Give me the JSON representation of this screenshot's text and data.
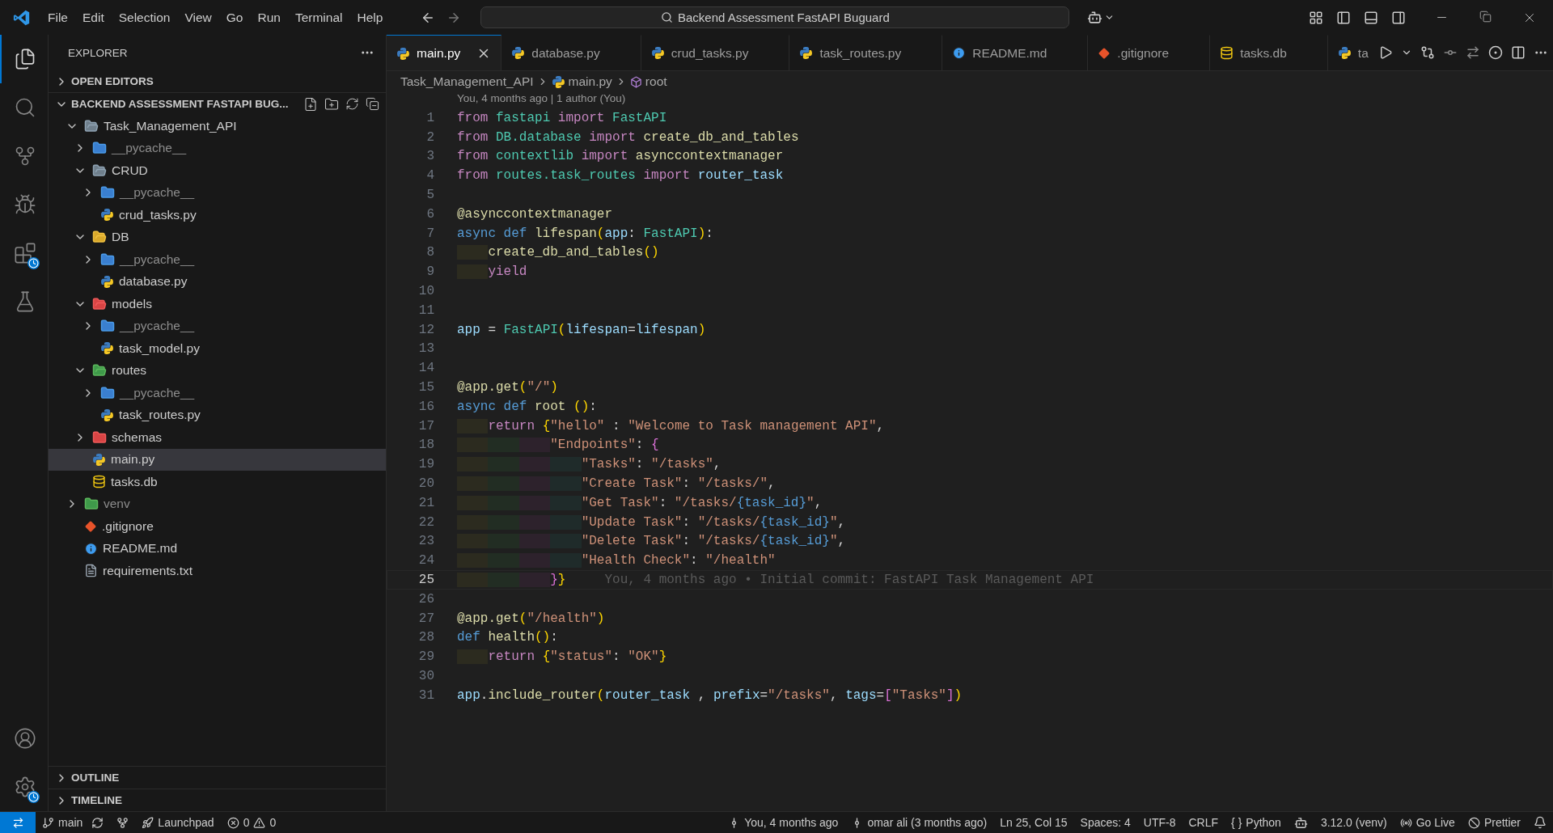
{
  "title_bar": {
    "menu": [
      "File",
      "Edit",
      "Selection",
      "View",
      "Go",
      "Run",
      "Terminal",
      "Help"
    ],
    "command_center": "Backend Assessment FastAPI Buguard"
  },
  "activity_bar": [
    {
      "kind": "explorer",
      "selected": true
    },
    {
      "kind": "search",
      "selected": false
    },
    {
      "kind": "scm",
      "selected": false
    },
    {
      "kind": "debug",
      "selected": false
    },
    {
      "kind": "extensions",
      "selected": false
    },
    {
      "kind": "testing",
      "selected": false
    }
  ],
  "activity_bar_bottom": [
    {
      "kind": "account"
    },
    {
      "kind": "settings"
    }
  ],
  "sidebar": {
    "title": "EXPLORER",
    "open_editors": {
      "label": "OPEN EDITORS",
      "expanded": false
    },
    "project": {
      "label": "BACKEND ASSESSMENT FASTAPI BUG...",
      "expanded": true
    },
    "tree": [
      {
        "label": "Task_Management_API",
        "kind": "folder",
        "expanded": true,
        "selected": false,
        "dimmed": false,
        "children": [
          {
            "label": "__pycache__",
            "kind": "folder-py",
            "expanded": false,
            "selected": false,
            "dimmed": true
          },
          {
            "label": "CRUD",
            "kind": "folder",
            "expanded": true,
            "selected": false,
            "dimmed": false,
            "children": [
              {
                "label": "__pycache__",
                "kind": "folder-py",
                "expanded": false,
                "selected": false,
                "dimmed": true
              },
              {
                "label": "crud_tasks.py",
                "kind": "python",
                "selected": false,
                "dimmed": false
              }
            ]
          },
          {
            "label": "DB",
            "kind": "folder-db",
            "expanded": true,
            "selected": false,
            "dimmed": false,
            "children": [
              {
                "label": "__pycache__",
                "kind": "folder-py",
                "expanded": false,
                "selected": false,
                "dimmed": true
              },
              {
                "label": "database.py",
                "kind": "python",
                "selected": false,
                "dimmed": false
              }
            ]
          },
          {
            "label": "models",
            "kind": "folder-red",
            "expanded": true,
            "selected": false,
            "dimmed": false,
            "children": [
              {
                "label": "__pycache__",
                "kind": "folder-py",
                "expanded": false,
                "selected": false,
                "dimmed": true
              },
              {
                "label": "task_model.py",
                "kind": "python",
                "selected": false,
                "dimmed": false
              }
            ]
          },
          {
            "label": "routes",
            "kind": "folder-green",
            "expanded": true,
            "selected": false,
            "dimmed": false,
            "children": [
              {
                "label": "__pycache__",
                "kind": "folder-py",
                "expanded": false,
                "selected": false,
                "dimmed": true
              },
              {
                "label": "task_routes.py",
                "kind": "python",
                "selected": false,
                "dimmed": false
              }
            ]
          },
          {
            "label": "schemas",
            "kind": "folder-red",
            "expanded": false,
            "selected": false,
            "dimmed": false
          },
          {
            "label": "main.py",
            "kind": "python",
            "selected": true,
            "dimmed": false
          },
          {
            "label": "tasks.db",
            "kind": "db",
            "selected": false,
            "dimmed": false
          }
        ]
      },
      {
        "label": "venv",
        "kind": "folder-green",
        "expanded": false,
        "selected": false,
        "dimmed": true
      },
      {
        "label": ".gitignore",
        "kind": "git",
        "selected": false,
        "dimmed": false
      },
      {
        "label": "README.md",
        "kind": "info",
        "selected": false,
        "dimmed": false
      },
      {
        "label": "requirements.txt",
        "kind": "text",
        "selected": false,
        "dimmed": false
      }
    ],
    "bottom_sections": [
      {
        "label": "OUTLINE",
        "expanded": false
      },
      {
        "label": "TIMELINE",
        "expanded": false
      }
    ]
  },
  "tabs": [
    {
      "label": "main.py",
      "kind": "python",
      "selected": true
    },
    {
      "label": "database.py",
      "kind": "python",
      "selected": false
    },
    {
      "label": "crud_tasks.py",
      "kind": "python",
      "selected": false
    },
    {
      "label": "task_routes.py",
      "kind": "python",
      "selected": false
    },
    {
      "label": "README.md",
      "kind": "info",
      "selected": false
    },
    {
      "label": ".gitignore",
      "kind": "git",
      "selected": false
    },
    {
      "label": "tasks.db",
      "kind": "db",
      "selected": false
    },
    {
      "label": "ta",
      "kind": "python",
      "selected": false
    }
  ],
  "breadcrumb": [
    {
      "label": "Task_Management_API",
      "kind": "folder"
    },
    {
      "label": "main.py",
      "kind": "python"
    },
    {
      "label": "root",
      "kind": "symbol"
    }
  ],
  "codelens": "You, 4 months ago | 1 author (You)",
  "code": [
    {
      "number": "1",
      "current": false,
      "tokens": [
        {
          "text": "from ",
          "kind": "kw"
        },
        {
          "text": "fastapi ",
          "kind": "ty"
        },
        {
          "text": "import ",
          "kind": "kw"
        },
        {
          "text": "FastAPI",
          "kind": "ty"
        }
      ]
    },
    {
      "number": "2",
      "current": false,
      "tokens": [
        {
          "text": "from ",
          "kind": "kw"
        },
        {
          "text": "DB.database ",
          "kind": "ty"
        },
        {
          "text": "import ",
          "kind": "kw"
        },
        {
          "text": "create_db_and_tables",
          "kind": "fn"
        }
      ]
    },
    {
      "number": "3",
      "current": false,
      "tokens": [
        {
          "text": "from ",
          "kind": "kw"
        },
        {
          "text": "contextlib ",
          "kind": "ty"
        },
        {
          "text": "import ",
          "kind": "kw"
        },
        {
          "text": "asynccontextmanager",
          "kind": "fn"
        }
      ]
    },
    {
      "number": "4",
      "current": false,
      "tokens": [
        {
          "text": "from ",
          "kind": "kw"
        },
        {
          "text": "routes.task_routes ",
          "kind": "ty"
        },
        {
          "text": "import ",
          "kind": "kw"
        },
        {
          "text": "router_task",
          "kind": "var"
        }
      ]
    },
    {
      "number": "5",
      "current": false
    },
    {
      "number": "6",
      "current": false,
      "tokens": [
        {
          "text": "@asynccontextmanager",
          "kind": "fn"
        }
      ]
    },
    {
      "number": "7",
      "current": false,
      "tokens": [
        {
          "text": "async def ",
          "kind": "st"
        },
        {
          "text": "lifespan",
          "kind": "fn"
        },
        {
          "text": "(",
          "kind": "br1"
        },
        {
          "text": "app",
          "kind": "var"
        },
        {
          "text": ": ",
          "kind": "plain"
        },
        {
          "text": "FastAPI",
          "kind": "ty"
        },
        {
          "text": ")",
          "kind": "br1"
        },
        {
          "text": ":",
          "kind": "plain"
        }
      ]
    },
    {
      "number": "8",
      "current": false,
      "tokens": [
        {
          "text": "    create_db_and_tables",
          "kind": "fn"
        },
        {
          "text": "()",
          "kind": "br1"
        }
      ]
    },
    {
      "number": "9",
      "current": false,
      "tokens": [
        {
          "text": "    yield",
          "kind": "kw"
        }
      ]
    },
    {
      "number": "10",
      "current": false
    },
    {
      "number": "11",
      "current": false
    },
    {
      "number": "12",
      "current": false,
      "tokens": [
        {
          "text": "app",
          "kind": "var"
        },
        {
          "text": " = ",
          "kind": "plain"
        },
        {
          "text": "FastAPI",
          "kind": "ty"
        },
        {
          "text": "(",
          "kind": "br1"
        },
        {
          "text": "lifespan",
          "kind": "var"
        },
        {
          "text": "=",
          "kind": "plain"
        },
        {
          "text": "lifespan",
          "kind": "var"
        },
        {
          "text": ")",
          "kind": "br1"
        }
      ]
    },
    {
      "number": "13",
      "current": false
    },
    {
      "number": "14",
      "current": false
    },
    {
      "number": "15",
      "current": false,
      "tokens": [
        {
          "text": "@app.get",
          "kind": "fn"
        },
        {
          "text": "(",
          "kind": "br1"
        },
        {
          "text": "\"/\"",
          "kind": "str"
        },
        {
          "text": ")",
          "kind": "br1"
        }
      ]
    },
    {
      "number": "16",
      "current": false,
      "tokens": [
        {
          "text": "async def ",
          "kind": "st"
        },
        {
          "text": "root ",
          "kind": "fn"
        },
        {
          "text": "()",
          "kind": "br1"
        },
        {
          "text": ":",
          "kind": "plain"
        }
      ]
    },
    {
      "number": "17",
      "current": false,
      "tokens": [
        {
          "text": "    return ",
          "kind": "kw"
        },
        {
          "text": "{",
          "kind": "br1"
        },
        {
          "text": "\"hello\"",
          "kind": "str"
        },
        {
          "text": " : ",
          "kind": "plain"
        },
        {
          "text": "\"Welcome to Task management API\"",
          "kind": "str"
        },
        {
          "text": ",",
          "kind": "plain"
        }
      ]
    },
    {
      "number": "18",
      "current": false,
      "tokens": [
        {
          "text": "            \"Endpoints\"",
          "kind": "str"
        },
        {
          "text": ": ",
          "kind": "plain"
        },
        {
          "text": "{",
          "kind": "br2"
        }
      ]
    },
    {
      "number": "19",
      "current": false,
      "tokens": [
        {
          "text": "                \"Tasks\"",
          "kind": "str"
        },
        {
          "text": ": ",
          "kind": "plain"
        },
        {
          "text": "\"/tasks\"",
          "kind": "str"
        },
        {
          "text": ",",
          "kind": "plain"
        }
      ]
    },
    {
      "number": "20",
      "current": false,
      "tokens": [
        {
          "text": "                \"Create Task\"",
          "kind": "str"
        },
        {
          "text": ": ",
          "kind": "plain"
        },
        {
          "text": "\"/tasks/\"",
          "kind": "str"
        },
        {
          "text": ",",
          "kind": "plain"
        }
      ]
    },
    {
      "number": "21",
      "current": false,
      "tokens": [
        {
          "text": "                \"Get Task\"",
          "kind": "str"
        },
        {
          "text": ": ",
          "kind": "plain"
        },
        {
          "text": "\"/tasks/",
          "kind": "str"
        },
        {
          "text": "{task_id}",
          "kind": "ph"
        },
        {
          "text": "\"",
          "kind": "str"
        },
        {
          "text": ",",
          "kind": "plain"
        }
      ]
    },
    {
      "number": "22",
      "current": false,
      "tokens": [
        {
          "text": "                \"Update Task\"",
          "kind": "str"
        },
        {
          "text": ": ",
          "kind": "plain"
        },
        {
          "text": "\"/tasks/",
          "kind": "str"
        },
        {
          "text": "{task_id}",
          "kind": "ph"
        },
        {
          "text": "\"",
          "kind": "str"
        },
        {
          "text": ",",
          "kind": "plain"
        }
      ]
    },
    {
      "number": "23",
      "current": false,
      "tokens": [
        {
          "text": "                \"Delete Task\"",
          "kind": "str"
        },
        {
          "text": ": ",
          "kind": "plain"
        },
        {
          "text": "\"/tasks/",
          "kind": "str"
        },
        {
          "text": "{task_id}",
          "kind": "ph"
        },
        {
          "text": "\"",
          "kind": "str"
        },
        {
          "text": ",",
          "kind": "plain"
        }
      ]
    },
    {
      "number": "24",
      "current": false,
      "tokens": [
        {
          "text": "                \"Health Check\"",
          "kind": "str"
        },
        {
          "text": ": ",
          "kind": "plain"
        },
        {
          "text": "\"/health\"",
          "kind": "str"
        }
      ]
    },
    {
      "number": "25",
      "current": true,
      "tokens": [
        {
          "text": "            }",
          "kind": "br2"
        },
        {
          "text": "}",
          "kind": "br1"
        }
      ],
      "blame": "You, 4 months ago • Initial commit: FastAPI Task Management API"
    },
    {
      "number": "26",
      "current": false
    },
    {
      "number": "27",
      "current": false,
      "tokens": [
        {
          "text": "@app.get",
          "kind": "fn"
        },
        {
          "text": "(",
          "kind": "br1"
        },
        {
          "text": "\"/health\"",
          "kind": "str"
        },
        {
          "text": ")",
          "kind": "br1"
        }
      ]
    },
    {
      "number": "28",
      "current": false,
      "tokens": [
        {
          "text": "def ",
          "kind": "st"
        },
        {
          "text": "health",
          "kind": "fn"
        },
        {
          "text": "()",
          "kind": "br1"
        },
        {
          "text": ":",
          "kind": "plain"
        }
      ]
    },
    {
      "number": "29",
      "current": false,
      "tokens": [
        {
          "text": "    return ",
          "kind": "kw"
        },
        {
          "text": "{",
          "kind": "br1"
        },
        {
          "text": "\"status\"",
          "kind": "str"
        },
        {
          "text": ": ",
          "kind": "plain"
        },
        {
          "text": "\"OK\"",
          "kind": "str"
        },
        {
          "text": "}",
          "kind": "br1"
        }
      ]
    },
    {
      "number": "30",
      "current": false
    },
    {
      "number": "31",
      "current": false,
      "tokens": [
        {
          "text": "app",
          "kind": "var"
        },
        {
          "text": ".",
          "kind": "plain"
        },
        {
          "text": "include_router",
          "kind": "fn"
        },
        {
          "text": "(",
          "kind": "br1"
        },
        {
          "text": "router_task",
          "kind": "var"
        },
        {
          "text": " , ",
          "kind": "plain"
        },
        {
          "text": "prefix",
          "kind": "var"
        },
        {
          "text": "=",
          "kind": "plain"
        },
        {
          "text": "\"/tasks\"",
          "kind": "str"
        },
        {
          "text": ", ",
          "kind": "plain"
        },
        {
          "text": "tags",
          "kind": "var"
        },
        {
          "text": "=",
          "kind": "plain"
        },
        {
          "text": "[",
          "kind": "br2"
        },
        {
          "text": "\"Tasks\"",
          "kind": "str"
        },
        {
          "text": "]",
          "kind": "br2"
        },
        {
          "text": ")",
          "kind": "br1"
        }
      ]
    }
  ],
  "status_bar": {
    "branch": "main",
    "launchpad": "Launchpad",
    "errors": "0",
    "warnings": "0",
    "right": [
      {
        "kind": "commit",
        "text": "You, 4 months ago"
      },
      {
        "kind": "commit",
        "text": "omar ali (3 months ago)"
      },
      {
        "kind": "plain",
        "text": "Ln 25, Col 15"
      },
      {
        "kind": "plain",
        "text": "Spaces: 4"
      },
      {
        "kind": "plain",
        "text": "UTF-8"
      },
      {
        "kind": "plain",
        "text": "CRLF"
      },
      {
        "kind": "language",
        "glyph": "{ }",
        "text": "Python"
      },
      {
        "kind": "copilot"
      },
      {
        "kind": "plain",
        "text": "3.12.0 (venv)"
      },
      {
        "kind": "live",
        "text": "Go Live"
      },
      {
        "kind": "prettier",
        "text": "Prettier"
      },
      {
        "kind": "bell"
      }
    ]
  }
}
